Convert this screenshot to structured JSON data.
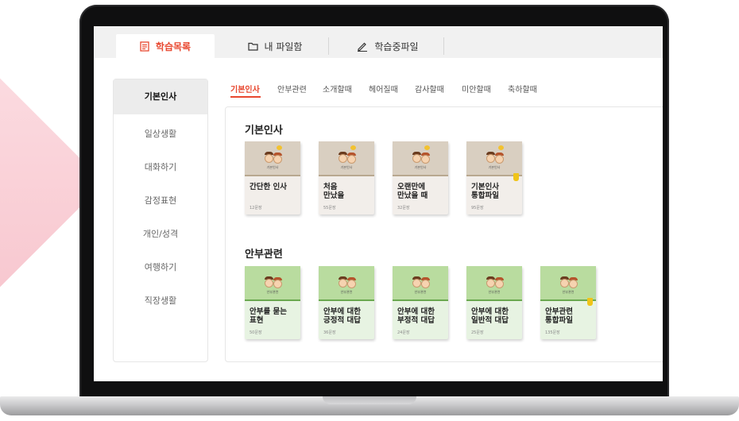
{
  "top_tabs": [
    {
      "label": "학습목록",
      "icon": "list-icon"
    },
    {
      "label": "내 파일함",
      "icon": "folder-icon"
    },
    {
      "label": "학습중파일",
      "icon": "pencil-icon"
    }
  ],
  "sidebar": {
    "items": [
      "기본인사",
      "일상생활",
      "대화하기",
      "감정표현",
      "개인/성격",
      "여행하기",
      "직장생활"
    ]
  },
  "subtabs": [
    "기본인사",
    "안부관련",
    "소개할때",
    "헤어질때",
    "감사할때",
    "미안할때",
    "축하할때"
  ],
  "sections": [
    {
      "title": "기본인사",
      "theme": "beige",
      "thumb_caption": "기본인사",
      "cards": [
        {
          "title": "간단한 인사",
          "count": "12문장"
        },
        {
          "title": "처음\n만났을",
          "count": "55문장"
        },
        {
          "title": "오랜만에\n만났을 때",
          "count": "32문장"
        },
        {
          "title": "기본인사\n통합파일",
          "count": "95문장"
        }
      ]
    },
    {
      "title": "안부관련",
      "theme": "green",
      "thumb_caption": "안부관련",
      "cards": [
        {
          "title": "안부를 묻는\n표현",
          "count": "50문장"
        },
        {
          "title": "안부에 대한\n긍정적 대답",
          "count": "36문장"
        },
        {
          "title": "안부에 대한\n부정적 대답",
          "count": "24문장"
        },
        {
          "title": "안부에 대한\n일반적 대답",
          "count": "25문장"
        },
        {
          "title": "안부관련\n통합파일",
          "count": "135문장"
        }
      ]
    }
  ],
  "colors": {
    "accent": "#e8472f",
    "beige": "#d9cfc1",
    "green": "#b9dc9f"
  }
}
